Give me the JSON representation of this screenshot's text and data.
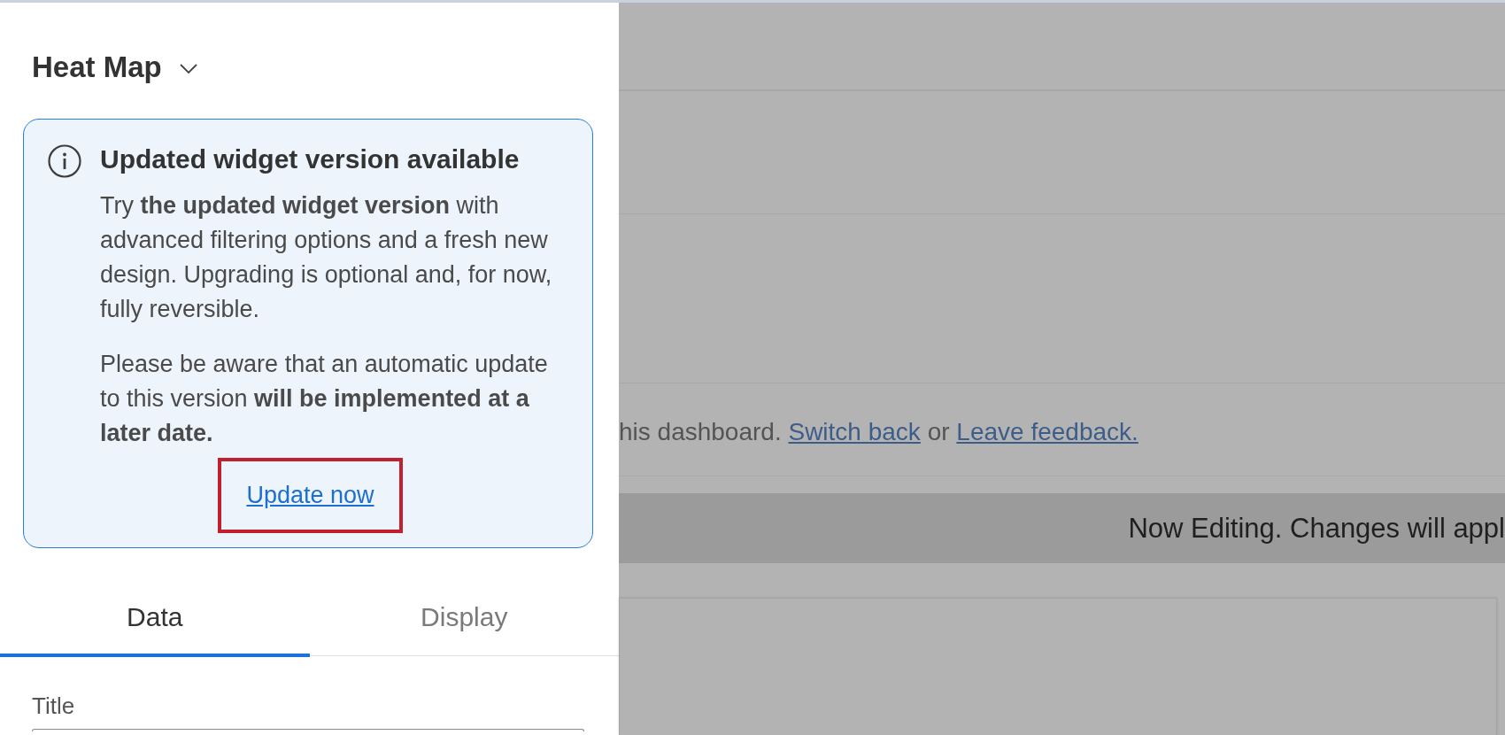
{
  "panel": {
    "widget_selector": {
      "label": "Heat Map"
    },
    "notice": {
      "title": "Updated widget version available",
      "paragraphs": [
        "Try **the updated widget version** with advanced filtering options and a fresh new design. Upgrading is optional and, for now, fully reversible.",
        "Please be aware that an automatic update to this version **will be implemented at a later date.**"
      ],
      "action": {
        "label": "Update now",
        "highlighted": true
      }
    },
    "tabs": [
      {
        "label": "Data",
        "selected": true
      },
      {
        "label": "Display",
        "selected": false
      }
    ],
    "fields": [
      {
        "label": "Title"
      }
    ]
  },
  "dashboard": {
    "notice": {
      "parts": [
        {
          "kind": "text",
          "text": "his dashboard."
        },
        {
          "kind": "link",
          "text": "Switch back"
        },
        {
          "kind": "text",
          "text": "or"
        },
        {
          "kind": "link",
          "text": "Leave feedback."
        }
      ]
    },
    "editing_banner": {
      "text": "Now Editing. Changes will appl"
    }
  }
}
